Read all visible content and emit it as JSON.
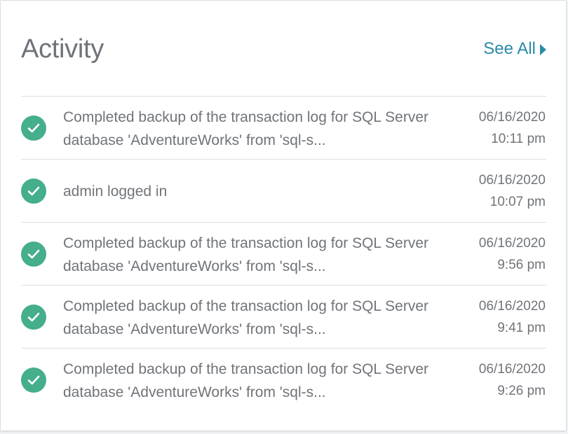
{
  "header": {
    "title": "Activity",
    "see_all_label": "See All"
  },
  "colors": {
    "accent": "#2b8ba7",
    "success": "#45ae8c",
    "text": "#707479"
  },
  "activity": [
    {
      "status": "success",
      "icon": "check-circle-icon",
      "line1": "Completed backup of the transaction log for SQL Server",
      "line2": "database 'AdventureWorks' from 'sql-s...",
      "date": "06/16/2020",
      "time": "10:11 pm"
    },
    {
      "status": "success",
      "icon": "check-circle-icon",
      "line1": "admin logged in",
      "line2": "",
      "date": "06/16/2020",
      "time": "10:07 pm"
    },
    {
      "status": "success",
      "icon": "check-circle-icon",
      "line1": "Completed backup of the transaction log for SQL Server",
      "line2": "database 'AdventureWorks' from 'sql-s...",
      "date": "06/16/2020",
      "time": "9:56 pm"
    },
    {
      "status": "success",
      "icon": "check-circle-icon",
      "line1": "Completed backup of the transaction log for SQL Server",
      "line2": "database 'AdventureWorks' from 'sql-s...",
      "date": "06/16/2020",
      "time": "9:41 pm"
    },
    {
      "status": "success",
      "icon": "check-circle-icon",
      "line1": "Completed backup of the transaction log for SQL Server",
      "line2": "database 'AdventureWorks' from 'sql-s...",
      "date": "06/16/2020",
      "time": "9:26 pm"
    }
  ]
}
